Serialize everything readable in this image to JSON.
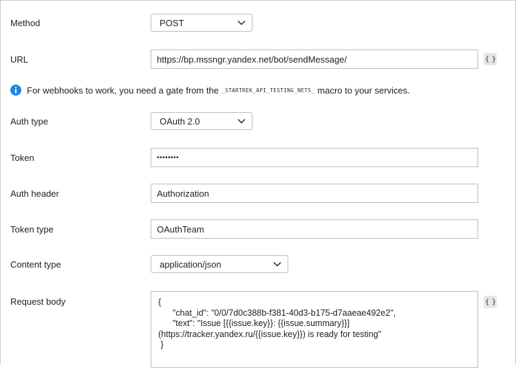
{
  "form": {
    "method": {
      "label": "Method",
      "value": "POST"
    },
    "url": {
      "label": "URL",
      "value": "https://bp.mssngr.yandex.net/bot/sendMessage/",
      "insert_button": "{ }"
    },
    "info": {
      "text_before": "For webhooks to work, you need a gate from the",
      "code": "_STARTREK_API_TESTING_NETS_",
      "text_after": "macro to your services."
    },
    "auth_type": {
      "label": "Auth type",
      "value": "OAuth 2.0"
    },
    "token": {
      "label": "Token",
      "value": "••••••••"
    },
    "auth_header": {
      "label": "Auth header",
      "value": "Authorization"
    },
    "token_type": {
      "label": "Token type",
      "value": "OAuthTeam"
    },
    "content_type": {
      "label": "Content type",
      "value": "application/json"
    },
    "request_body": {
      "label": "Request body",
      "value": "{\n      \"chat_id\": \"0/0/7d0c388b-f381-40d3-b175-d7aaeae492e2\",\n      \"text\": \"Issue [{{issue.key}}: {{issue.summary}}]\n(https://tracker.yandex.ru/{{issue.key}}) is ready for testing\"\n }",
      "insert_button": "{ }"
    }
  },
  "colors": {
    "info_icon": "#1e88e5",
    "border": "#bcbcbc",
    "button_bg": "#e6e6e6"
  },
  "icons": {
    "info": "info-icon",
    "chevron": "chevron-down-icon"
  }
}
